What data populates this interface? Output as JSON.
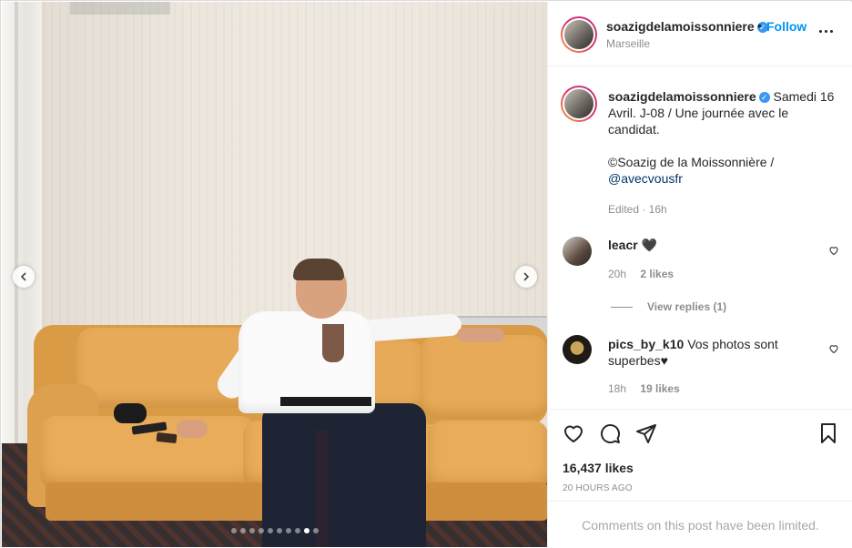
{
  "photo": {
    "carousel_count": 10,
    "carousel_active_index": 8,
    "prev_icon": "chevron-left-icon",
    "next_icon": "chevron-right-icon"
  },
  "header": {
    "username": "soazigdelamoissonniere",
    "separator": "•",
    "follow_label": "Follow",
    "location": "Marseille",
    "more_icon": "more-options-icon"
  },
  "caption": {
    "username": "soazigdelamoissonniere",
    "line1": "Samedi 16 Avril. J-08 / Une journée avec le candidat.",
    "line2": "©Soazig de la Moissonnière /",
    "mention": "@avecvousfr",
    "edited": "Edited · 16h"
  },
  "comments": [
    {
      "username": "leacr",
      "text": "",
      "emoji": "🖤",
      "time": "20h",
      "likes": "2 likes",
      "view_replies": "View replies (1)"
    },
    {
      "username": "pics_by_k10",
      "text": "Vos photos sont superbes♥",
      "time": "18h",
      "likes": "19 likes"
    }
  ],
  "actions": {
    "like_icon": "heart-icon",
    "comment_icon": "comment-icon",
    "share_icon": "send-icon",
    "save_icon": "bookmark-icon",
    "likes": "16,437 likes",
    "posted": "20 HOURS AGO",
    "comments_limited": "Comments on this post have been limited."
  },
  "colors": {
    "link": "#0095f6",
    "muted": "#8e8e8e",
    "text": "#262626",
    "verified": "#3897f0"
  }
}
